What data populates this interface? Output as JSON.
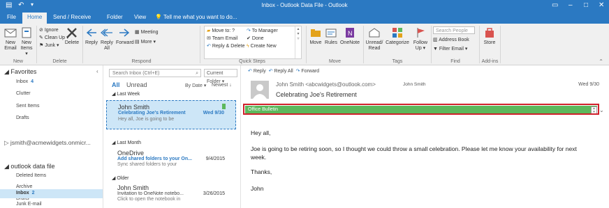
{
  "title_bar": {
    "title": "Inbox - Outlook Data File - Outlook"
  },
  "tabs": {
    "file": "File",
    "home": "Home",
    "send_receive": "Send / Receive",
    "folder": "Folder",
    "view": "View",
    "tell_me": "Tell me what you want to do..."
  },
  "ribbon": {
    "new_email": "New\nEmail",
    "new_items": "New\nItems ▾",
    "ignore": "Ignore",
    "clean_up": "Clean Up ▾",
    "junk": "Junk ▾",
    "delete": "Delete",
    "reply": "Reply",
    "reply_all": "Reply\nAll",
    "forward": "Forward",
    "meeting": "Meeting",
    "more": "More ▾",
    "qs_move_to": "Move to: ?",
    "qs_team_email": "Team Email",
    "qs_reply_delete": "Reply & Delete",
    "qs_to_manager": "To Manager",
    "qs_done": "Done",
    "qs_create_new": "Create New",
    "move": "Move",
    "rules": "Rules",
    "onenote": "OneNote",
    "unread_read": "Unread/\nRead",
    "categorize": "Categorize",
    "follow_up": "Follow\nUp ▾",
    "search_people": "Search People",
    "address_book": "Address Book",
    "filter_email": "Filter Email ▾",
    "store": "Store",
    "groups": {
      "new": "New",
      "delete": "Delete",
      "respond": "Respond",
      "quick_steps": "Quick Steps",
      "move": "Move",
      "tags": "Tags",
      "find": "Find",
      "addins": "Add-ins"
    }
  },
  "nav": {
    "favorites": "◢ Favorites",
    "fav_items": [
      {
        "label": "Inbox",
        "count": "4"
      },
      {
        "label": "Clutter"
      },
      {
        "label": "Sent Items"
      },
      {
        "label": "Drafts"
      }
    ],
    "account": "▷ jsmith@acmewidgets.onmicr...",
    "data_file": "◢ outlook data file",
    "df_items": [
      {
        "label": "Deleted Items"
      },
      {
        "label": "Archive"
      },
      {
        "label": "Drafts"
      },
      {
        "label": "Inbox",
        "count": "2"
      },
      {
        "label": "Junk E-mail"
      }
    ]
  },
  "list": {
    "search_placeholder": "Search Inbox (Ctrl+E)",
    "current_folder": "Current Folder ▾",
    "all": "All",
    "unread": "Unread",
    "by_date": "By Date ▾",
    "newest": "Newest ↓",
    "groups": [
      "◢ Last Week",
      "◢ Last Month",
      "◢ Older"
    ],
    "messages": [
      {
        "from": "John Smith",
        "subject": "Celebrating Joe's Retirement",
        "preview": "Hey all,  Joe is going to be",
        "date": "Wed 9/30"
      },
      {
        "from": "OneDrive",
        "subject": "Add shared folders to your On...",
        "preview": "Sync shared folders to your",
        "date": "9/4/2015"
      },
      {
        "from": "John Smith",
        "subject": "Invitation to OneNote notebo...",
        "preview": "Click to open the notebook in",
        "date": "3/26/2015"
      }
    ]
  },
  "reading": {
    "reply": "Reply",
    "reply_all": "Reply All",
    "forward": "Forward",
    "sender": "John Smith <abcwidgets@outlook.com>",
    "sender_name": "John Smith",
    "date": "Wed 9/30",
    "subject": "Celebrating Joe's Retirement",
    "bulletin": "Office Bulletin",
    "body": [
      "Hey all,",
      "Joe is going to be retiring soon, so I thought we could  throw a small celebration. Please let me know your availability for next",
      "week.",
      "Thanks,",
      "John"
    ]
  },
  "colors": {
    "accent": "#2b79c2",
    "bulletin": "#5cb85c",
    "highlight": "#d01f2a"
  }
}
